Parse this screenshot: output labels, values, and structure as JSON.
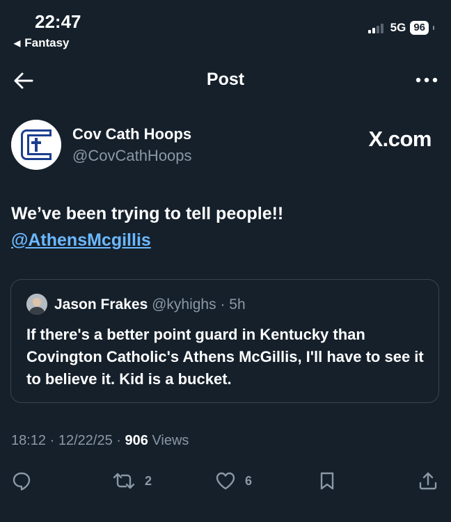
{
  "status_bar": {
    "time": "22:47",
    "back_app": "Fantasy",
    "network": "5G",
    "battery": "96"
  },
  "header": {
    "title": "Post"
  },
  "author": {
    "display_name": "Cov Cath Hoops",
    "handle": "@CovCathHoops",
    "watermark": "X.com"
  },
  "tweet": {
    "text": "We’ve been trying to tell people!!",
    "mention": "@AthensMcgillis"
  },
  "quote": {
    "name": "Jason Frakes",
    "handle_time": "@kyhighs · 5h",
    "text": "If there's a better point guard in Kentucky than Covington Catholic's Athens McGillis, I'll have to see it to believe it. Kid is a bucket."
  },
  "meta": {
    "time": "18:12",
    "date": "12/22/25",
    "views_count": "906",
    "views_label": "Views"
  },
  "actions": {
    "reply_icon": "reply-icon",
    "retweets": "2",
    "likes": "6",
    "bookmark_icon": "bookmark-icon",
    "share_icon": "share-icon"
  },
  "colors": {
    "background": "#15202b",
    "link": "#6cb8ff",
    "secondary_text": "#8b98a5",
    "border": "#38444d"
  }
}
